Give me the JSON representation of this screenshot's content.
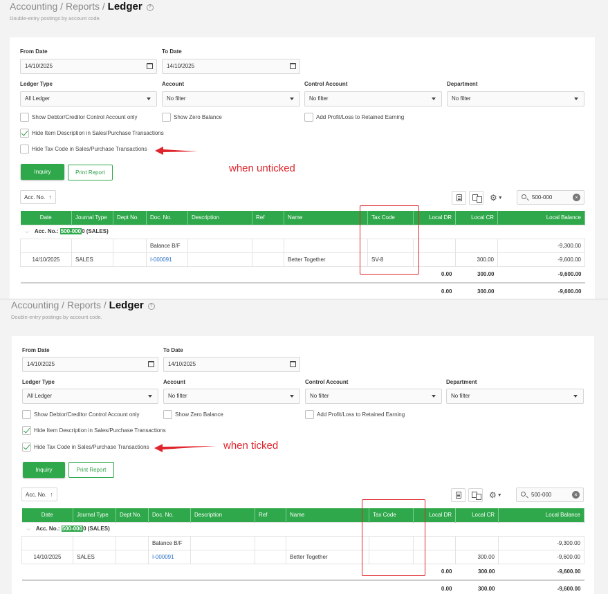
{
  "screens": [
    {
      "breadcrumb": {
        "root": "Accounting",
        "sep": "/",
        "mid": "Reports",
        "current": "Ledger"
      },
      "subtitle": "Double-entry postings by account code.",
      "filters": {
        "from_date_label": "From Date",
        "from_date_value": "14/10/2025",
        "to_date_label": "To Date",
        "to_date_value": "14/10/2025",
        "ledger_type_label": "Ledger Type",
        "ledger_type_value": "All Ledger",
        "account_label": "Account",
        "account_value": "No filter",
        "control_account_label": "Control Account",
        "control_account_value": "No filter",
        "department_label": "Department",
        "department_value": "No filter"
      },
      "checkboxes": [
        {
          "label": "Show Debtor/Creditor Control Account only",
          "checked": false
        },
        {
          "label": "Show Zero Balance",
          "checked": false
        },
        {
          "label": "Add Profit/Loss to Retained Earning",
          "checked": false
        },
        {
          "label": "Hide Item Description in Sales/Purchase Transactions",
          "checked": true
        },
        {
          "label": "Hide Tax Code in Sales/Purchase Transactions",
          "checked": false
        }
      ],
      "buttons": {
        "inquiry": "Inquiry",
        "print": "Print Report"
      },
      "annotation": "when unticked",
      "sort": "Acc. No.",
      "search_value": "500-000",
      "columns": [
        "Date",
        "Journal Type",
        "Dept No.",
        "Doc. No.",
        "Description",
        "Ref",
        "Name",
        "Tax Code",
        "Local DR",
        "Local CR",
        "Local Balance"
      ],
      "group": {
        "prefix": "Acc. No.:",
        "highlight": "500-000",
        "suffix": "0 (SALES)"
      },
      "rows": [
        {
          "date": "",
          "journal": "",
          "dept": "",
          "doc": "Balance B/F",
          "desc": "",
          "ref": "",
          "name": "",
          "tax": "",
          "dr": "",
          "cr": "",
          "bal": "-9,300.00"
        },
        {
          "date": "14/10/2025",
          "journal": "SALES",
          "dept": "",
          "doc": "I-000091",
          "desc": "",
          "ref": "",
          "name": "Better Together",
          "tax": "SV-8",
          "dr": "",
          "cr": "300.00",
          "bal": "-9,600.00"
        }
      ],
      "subtotal": {
        "dr": "0.00",
        "cr": "300.00",
        "bal": "-9,600.00"
      },
      "total": {
        "dr": "0.00",
        "cr": "300.00",
        "bal": "-9,600.00"
      }
    },
    {
      "breadcrumb": {
        "root": "Accounting",
        "sep": "/",
        "mid": "Reports",
        "current": "Ledger"
      },
      "subtitle": "Double-entry postings by account code.",
      "filters": {
        "from_date_label": "From Date",
        "from_date_value": "14/10/2025",
        "to_date_label": "To Date",
        "to_date_value": "14/10/2025",
        "ledger_type_label": "Ledger Type",
        "ledger_type_value": "All Ledger",
        "account_label": "Account",
        "account_value": "No filter",
        "control_account_label": "Control Account",
        "control_account_value": "No filter",
        "department_label": "Department",
        "department_value": "No filter"
      },
      "checkboxes": [
        {
          "label": "Show Debtor/Creditor Control Account only",
          "checked": false
        },
        {
          "label": "Show Zero Balance",
          "checked": false
        },
        {
          "label": "Add Profit/Loss to Retained Earning",
          "checked": false
        },
        {
          "label": "Hide Item Description in Sales/Purchase Transactions",
          "checked": true
        },
        {
          "label": "Hide Tax Code in Sales/Purchase Transactions",
          "checked": true
        }
      ],
      "buttons": {
        "inquiry": "Inquiry",
        "print": "Print Report"
      },
      "annotation": "when ticked",
      "sort": "Acc. No.",
      "search_value": "500-000",
      "columns": [
        "Date",
        "Journal Type",
        "Dept No.",
        "Doc. No.",
        "Description",
        "Ref",
        "Name",
        "Tax Code",
        "Local DR",
        "Local CR",
        "Local Balance"
      ],
      "group": {
        "prefix": "Acc. No.:",
        "highlight": "500-000",
        "suffix": "0 (SALES)"
      },
      "rows": [
        {
          "date": "",
          "journal": "",
          "dept": "",
          "doc": "Balance B/F",
          "desc": "",
          "ref": "",
          "name": "",
          "tax": "",
          "dr": "",
          "cr": "",
          "bal": "-9,300.00"
        },
        {
          "date": "14/10/2025",
          "journal": "SALES",
          "dept": "",
          "doc": "I-000091",
          "desc": "",
          "ref": "",
          "name": "Better Together",
          "tax": "",
          "dr": "",
          "cr": "300.00",
          "bal": "-9,600.00"
        }
      ],
      "subtotal": {
        "dr": "0.00",
        "cr": "300.00",
        "bal": "-9,600.00"
      },
      "total": {
        "dr": "0.00",
        "cr": "300.00",
        "bal": "-9,600.00"
      }
    }
  ],
  "colors": {
    "accent": "#2ea84a",
    "annotation": "#e0242b",
    "link": "#2a6fc9"
  },
  "icons": [
    "calendar-icon",
    "chevron-down-icon",
    "checkmark-icon",
    "sort-up-icon",
    "export-icon",
    "copy-icon",
    "gear-icon",
    "search-icon",
    "clear-icon",
    "help-icon",
    "red-arrow"
  ]
}
